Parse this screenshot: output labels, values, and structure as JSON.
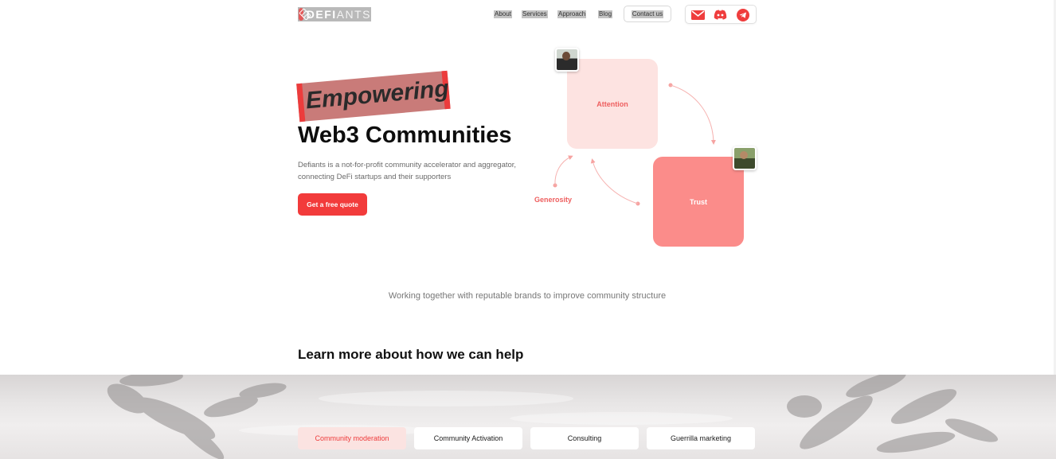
{
  "header": {
    "logo_text_bold": "DEFI",
    "logo_text_thin": "ANTS",
    "nav": [
      {
        "label": "About"
      },
      {
        "label": "Services"
      },
      {
        "label": "Approach"
      },
      {
        "label": "Blog"
      }
    ],
    "contact_label": "Contact us",
    "social_icons": [
      "mail-icon",
      "discord-icon",
      "telegram-icon"
    ]
  },
  "hero": {
    "highlight": "Empowering",
    "title": "Web3 Communities",
    "description": "Defiants is a not-for-profit community accelerator and aggregator, connecting DeFi startups and their supporters",
    "cta_label": "Get a free quote"
  },
  "diagram": {
    "attention": "Attention",
    "trust": "Trust",
    "generosity": "Generosity"
  },
  "brands_text": "Working together with reputable brands to improve community structure",
  "help_heading": "Learn more about how we can help",
  "tabs": [
    {
      "label": "Community moderation",
      "active": true
    },
    {
      "label": "Community Activation",
      "active": false
    },
    {
      "label": "Consulting",
      "active": false
    },
    {
      "label": "Guerrilla marketing",
      "active": false
    }
  ],
  "colors": {
    "accent": "#f23b3b",
    "attention_box": "#fde3e1",
    "trust_box": "#fb8c8a"
  }
}
